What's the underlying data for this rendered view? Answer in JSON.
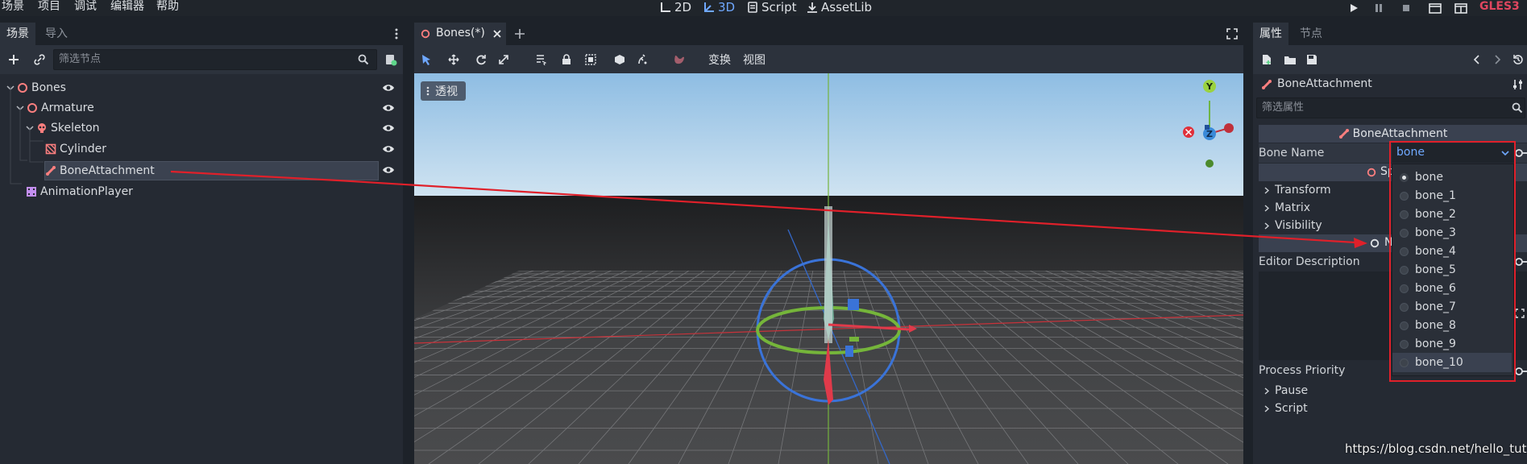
{
  "menu": {
    "items": [
      "场景",
      "项目",
      "调试",
      "编辑器",
      "帮助"
    ],
    "modes": {
      "mode_2d": "2D",
      "mode_3d": "3D",
      "script": "Script",
      "assetlib": "AssetLib"
    },
    "renderer": "GLES3"
  },
  "scene_dock": {
    "tabs": {
      "scene": "场景",
      "import": "导入"
    },
    "filter_placeholder": "筛选节点",
    "tree": {
      "bones": "Bones",
      "armature": "Armature",
      "skeleton": "Skeleton",
      "cylinder": "Cylinder",
      "bone_attachment": "BoneAttachment",
      "animation_player": "AnimationPlayer"
    }
  },
  "editor": {
    "scene_tab": "Bones(*)",
    "toolbar": {
      "transform": "变换",
      "view": "视图"
    },
    "perspective": "透视",
    "gizmo": {
      "y": "Y",
      "z": "Z"
    }
  },
  "inspector": {
    "tabs": {
      "inspector": "属性",
      "node": "节点"
    },
    "object_name": "BoneAttachment",
    "filter_placeholder": "筛选属性",
    "class_header": "BoneAttachment",
    "bone_name_label": "Bone Name",
    "bone_name_value": "bone",
    "spatial_header_partial": "Sp",
    "sections": {
      "transform": "Transform",
      "matrix": "Matrix",
      "visibility": "Visibility",
      "pause": "Pause",
      "script": "Script"
    },
    "node_header_partial": "N",
    "editor_description": "Editor Description",
    "process_priority": "Process Priority",
    "dropdown_options": [
      "bone",
      "bone_1",
      "bone_2",
      "bone_3",
      "bone_4",
      "bone_5",
      "bone_6",
      "bone_7",
      "bone_8",
      "bone_9",
      "bone_10"
    ]
  },
  "watermark": "https://blog.csdn.net/hello_tute",
  "colors": {
    "accent": "#6fa8ff",
    "annotation_red": "#e0202a",
    "renderer": "#e0465f"
  }
}
